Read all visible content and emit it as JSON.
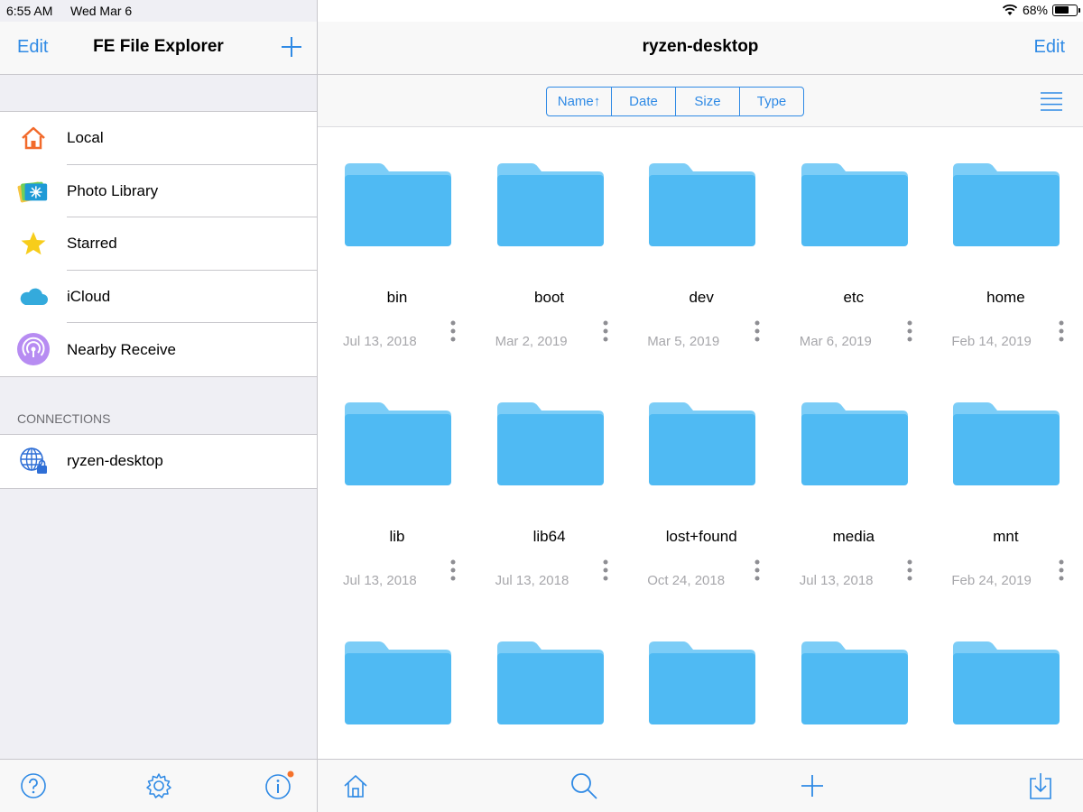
{
  "status_bar": {
    "time": "6:55 AM",
    "date": "Wed Mar 6",
    "battery": "68%",
    "battery_level": 0.68
  },
  "sidebar": {
    "edit_label": "Edit",
    "title": "FE File Explorer",
    "items": [
      {
        "label": "Local",
        "icon": "house-icon"
      },
      {
        "label": "Photo Library",
        "icon": "photo-library-icon"
      },
      {
        "label": "Starred",
        "icon": "star-icon"
      },
      {
        "label": "iCloud",
        "icon": "icloud-icon"
      },
      {
        "label": "Nearby Receive",
        "icon": "nearby-receive-icon"
      }
    ],
    "connections_header": "CONNECTIONS",
    "connections": [
      {
        "label": "ryzen-desktop",
        "icon": "globe-lock-icon"
      }
    ],
    "toolbar_icons": [
      "help-icon",
      "settings-icon",
      "info-icon"
    ]
  },
  "main": {
    "title": "ryzen-desktop",
    "edit_label": "Edit",
    "sort_options": [
      {
        "label": "Name",
        "selected": true,
        "arrow": "↑"
      },
      {
        "label": "Date"
      },
      {
        "label": "Size"
      },
      {
        "label": "Type"
      }
    ],
    "items": [
      {
        "name": "bin",
        "date": "Jul 13, 2018"
      },
      {
        "name": "boot",
        "date": "Mar 2, 2019"
      },
      {
        "name": "dev",
        "date": "Mar 5, 2019"
      },
      {
        "name": "etc",
        "date": "Mar 6, 2019"
      },
      {
        "name": "home",
        "date": "Feb 14, 2019"
      },
      {
        "name": "lib",
        "date": "Jul 13, 2018"
      },
      {
        "name": "lib64",
        "date": "Jul 13, 2018"
      },
      {
        "name": "lost+found",
        "date": "Oct 24, 2018"
      },
      {
        "name": "media",
        "date": "Jul 13, 2018"
      },
      {
        "name": "mnt",
        "date": "Feb 24, 2019"
      },
      {
        "name": "",
        "date": ""
      },
      {
        "name": "",
        "date": ""
      },
      {
        "name": "",
        "date": ""
      },
      {
        "name": "",
        "date": ""
      },
      {
        "name": "",
        "date": ""
      }
    ],
    "toolbar_icons": [
      "home-icon",
      "search-icon",
      "add-icon",
      "download-icon"
    ]
  },
  "colors": {
    "accent": "#2f8ae5",
    "folder": "#4fbaf3",
    "folder_tab": "#7ccdf7",
    "badge": "#f5722b"
  }
}
